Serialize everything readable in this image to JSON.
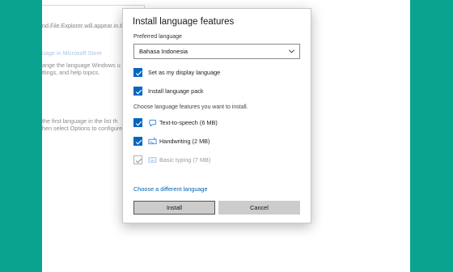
{
  "background": {
    "lines": [
      "nd File Explorer will appear in th",
      "uage in Microsoft Store",
      "ange the language Windows u",
      "ttings, and help topics.",
      "the first language in the list th",
      "hen select Options to configure"
    ]
  },
  "dialog": {
    "title": "Install language features",
    "preferred_label": "Preferred language",
    "preferred_value": "Bahasa Indonesia",
    "options": [
      {
        "label": "Set as my display language",
        "checked": true
      },
      {
        "label": "Install language pack",
        "checked": true
      }
    ],
    "features_label": "Choose language features you want to install.",
    "features": [
      {
        "label": "Text-to-speech (6 MB)",
        "icon": "speech-icon",
        "checked": true,
        "enabled": true
      },
      {
        "label": "Handwriting (2 MB)",
        "icon": "handwriting-icon",
        "checked": true,
        "enabled": true
      },
      {
        "label": "Basic typing (7 MB)",
        "icon": "keyboard-icon",
        "checked": true,
        "enabled": false
      }
    ],
    "change_link": "Choose a different language",
    "install_button": "Install",
    "cancel_button": "Cancel"
  },
  "colors": {
    "accent": "#0067c0",
    "teal_background": "#0aa38f",
    "link": "#0063b1"
  }
}
